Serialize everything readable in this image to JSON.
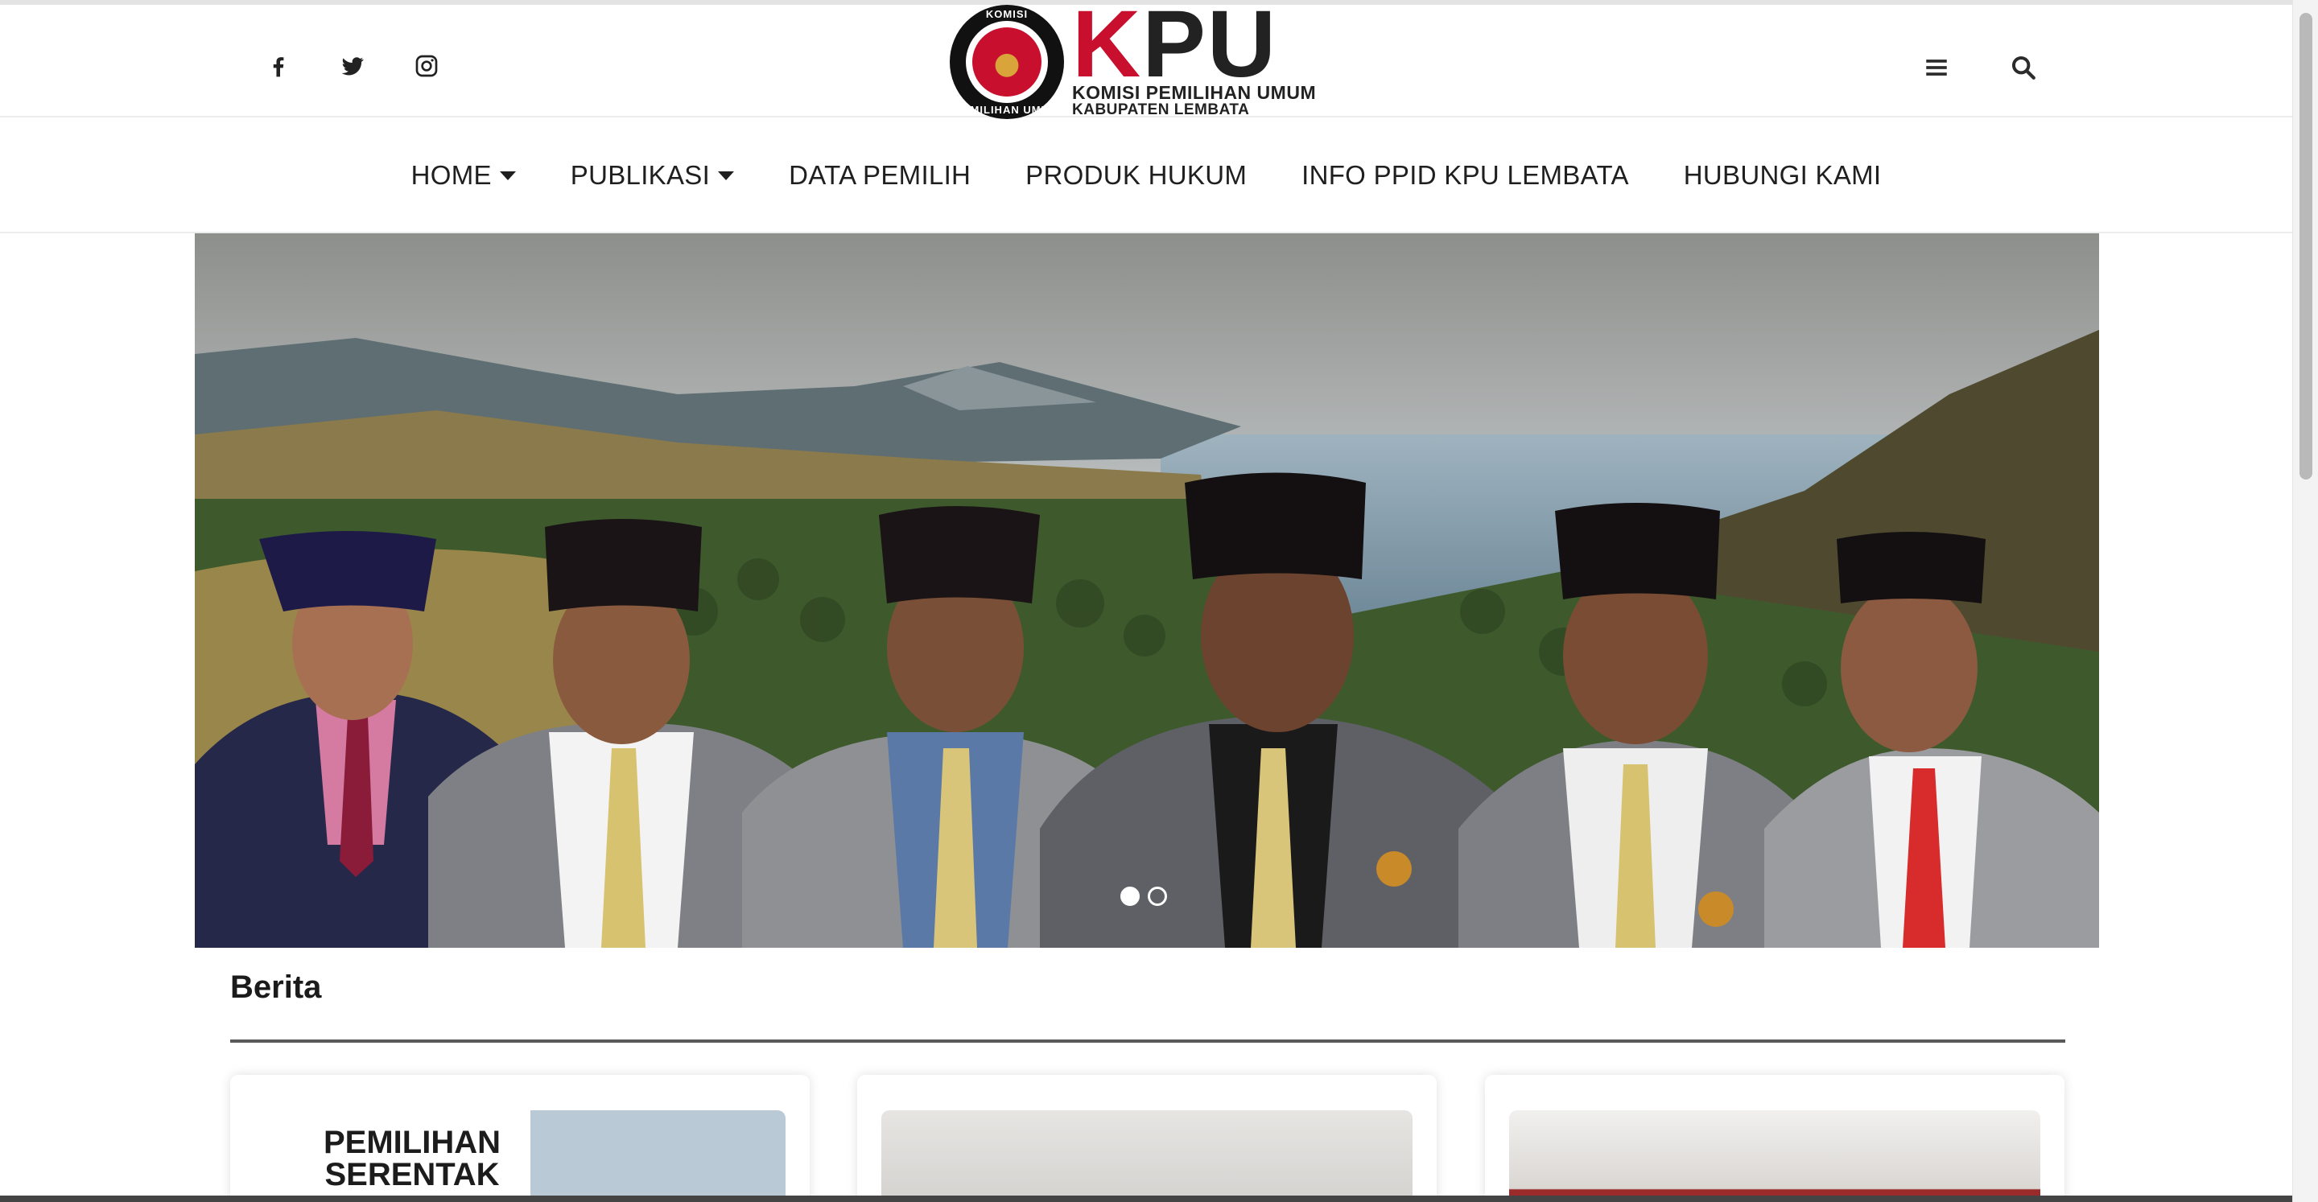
{
  "header": {
    "social": [
      "facebook-icon",
      "twitter-icon",
      "instagram-icon"
    ],
    "logo": {
      "ring_top": "KOMISI",
      "ring_bottom": "PEMILIHAN UMUM",
      "k": "K",
      "pu": "PU",
      "line1": "KOMISI PEMILIHAN UMUM",
      "line2": "KABUPATEN LEMBATA"
    },
    "right_icons": [
      "menu-icon",
      "search-icon"
    ]
  },
  "nav": {
    "items": [
      {
        "label": "HOME",
        "dropdown": true
      },
      {
        "label": "PUBLIKASI",
        "dropdown": true
      },
      {
        "label": "DATA PEMILIH",
        "dropdown": false
      },
      {
        "label": "PRODUK HUKUM",
        "dropdown": false
      },
      {
        "label": "INFO PPID KPU LEMBATA",
        "dropdown": false
      },
      {
        "label": "HUBUNGI KAMI",
        "dropdown": false
      }
    ]
  },
  "slider": {
    "slide_count": 2,
    "active_slide": 1
  },
  "news": {
    "title": "Berita",
    "cards": [
      {
        "thumb_text": "PEMILIHAN SERENTAK"
      },
      {
        "thumb_text": ""
      },
      {
        "thumb_text": ""
      }
    ]
  },
  "colors": {
    "brand_red": "#c8102e",
    "text": "#1f1f1f"
  }
}
